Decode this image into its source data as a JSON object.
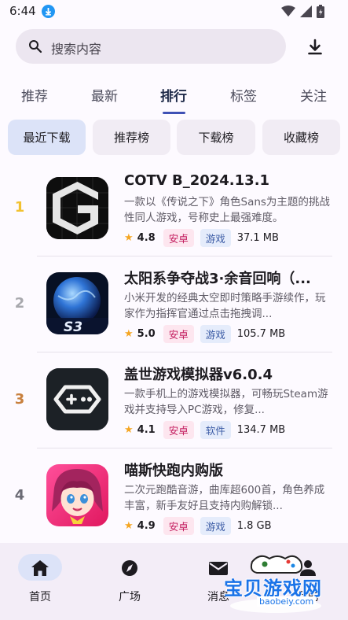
{
  "status_bar": {
    "time": "6:44"
  },
  "search": {
    "placeholder": "搜索内容"
  },
  "tabs": [
    {
      "label": "推荐"
    },
    {
      "label": "最新"
    },
    {
      "label": "排行"
    },
    {
      "label": "标签"
    },
    {
      "label": "关注"
    }
  ],
  "active_tab": "排行",
  "chips": [
    {
      "label": "最近下载"
    },
    {
      "label": "推荐榜"
    },
    {
      "label": "下载榜"
    },
    {
      "label": "收藏榜"
    }
  ],
  "selected_chip": "最近下载",
  "apps": [
    {
      "rank": "1",
      "rank_color": "#f2c230",
      "title": "COTV B_2024.13.1",
      "description": "一款以《传说之下》角色Sans为主题的挑战性同人游戏，号称史上最强难度。",
      "rating": "4.8",
      "platform": "安卓",
      "category": "游戏",
      "size": "37.1 MB",
      "icon": "gamemaker-logo-icon"
    },
    {
      "rank": "2",
      "rank_color": "#a8a8ad",
      "title": "太阳系争夺战3·余音回响（...",
      "description": "小米开发的经典太空即时策略手游续作，玩家作为指挥官通过点击拖拽调...",
      "rating": "5.0",
      "platform": "安卓",
      "category": "游戏",
      "size": "105.7 MB",
      "icon": "s3-planet-icon"
    },
    {
      "rank": "3",
      "rank_color": "#c8803e",
      "title": "盖世游戏模拟器v6.0.4",
      "description": "一款手机上的游戏模拟器，可畅玩Steam游戏并支持导入PC游戏，修复...",
      "rating": "4.1",
      "platform": "安卓",
      "category": "软件",
      "size": "134.7 MB",
      "icon": "gamepad-icon"
    },
    {
      "rank": "4",
      "rank_color": "#6b6b75",
      "title": "喵斯快跑内购版",
      "description": "二次元跑酷音游，曲库超600首，角色养成丰富，新手友好且支持内购解锁...",
      "rating": "4.9",
      "platform": "安卓",
      "category": "游戏",
      "size": "1.8 GB",
      "icon": "anime-girl-icon"
    }
  ],
  "bottom_nav": [
    {
      "label": "首页",
      "icon": "home-icon"
    },
    {
      "label": "广场",
      "icon": "compass-icon"
    },
    {
      "label": "消息",
      "icon": "mail-icon"
    },
    {
      "label": "我的",
      "icon": "person-icon"
    }
  ],
  "watermark": {
    "text": "宝贝游戏网",
    "url": "baobeiy.com"
  },
  "colors": {
    "accent": "#3f51b5",
    "chip_selected": "#dce3f8",
    "star": "#f5a623"
  }
}
